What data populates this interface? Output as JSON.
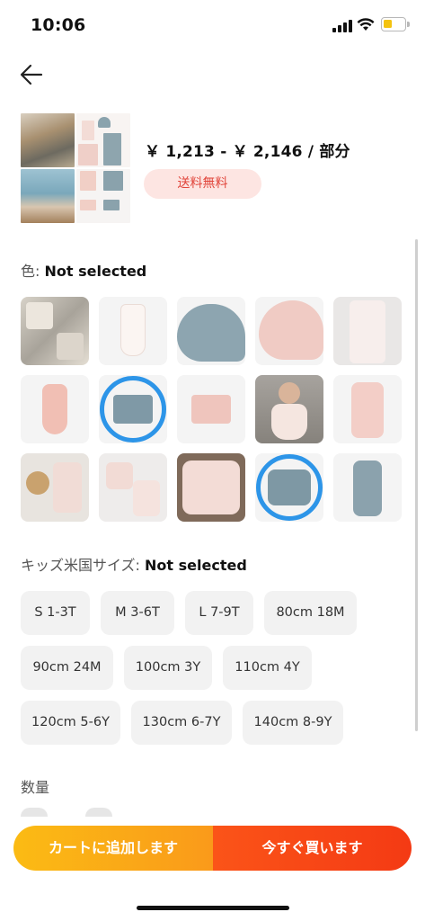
{
  "status_bar": {
    "time": "10:06",
    "battery_color": "#f4c310"
  },
  "header": {
    "back_icon": "arrow-left-icon"
  },
  "product": {
    "price_range": "￥ 1,213 - ￥ 2,146 / 部分",
    "shipping_badge": "送料無料"
  },
  "color_section": {
    "label": "色:",
    "value": "Not selected",
    "selected_highlight_color": "#2d95e8",
    "swatches": [
      {
        "name": "set-collage"
      },
      {
        "name": "white-swimsuit"
      },
      {
        "name": "blue-sun-hat"
      },
      {
        "name": "pink-sun-hat"
      },
      {
        "name": "pink-romper"
      },
      {
        "name": "pink-ruffle-swimsuit"
      },
      {
        "name": "blue-swim-shorts",
        "highlighted": true
      },
      {
        "name": "pink-swim-shorts"
      },
      {
        "name": "child-photo"
      },
      {
        "name": "pink-long-romper"
      },
      {
        "name": "accessories-flatlay"
      },
      {
        "name": "pink-set-flatlay"
      },
      {
        "name": "pink-rash-guard"
      },
      {
        "name": "blue-rash-guard",
        "highlighted": true
      },
      {
        "name": "blue-long-romper"
      }
    ]
  },
  "size_section": {
    "label": "キッズ米国サイズ:",
    "value": "Not selected",
    "options": [
      "S  1-3T",
      "M  3-6T",
      "L  7-9T",
      "80cm 18M",
      "90cm 24M",
      "100cm 3Y",
      "110cm 4Y",
      "120cm 5-6Y",
      "130cm 6-7Y",
      "140cm 8-9Y"
    ]
  },
  "quantity_section": {
    "label": "数量"
  },
  "actions": {
    "add_to_cart": "カートに追加します",
    "buy_now": "今すぐ買います",
    "cart_color": "#fbbb14",
    "buy_color": "#f43a14"
  }
}
